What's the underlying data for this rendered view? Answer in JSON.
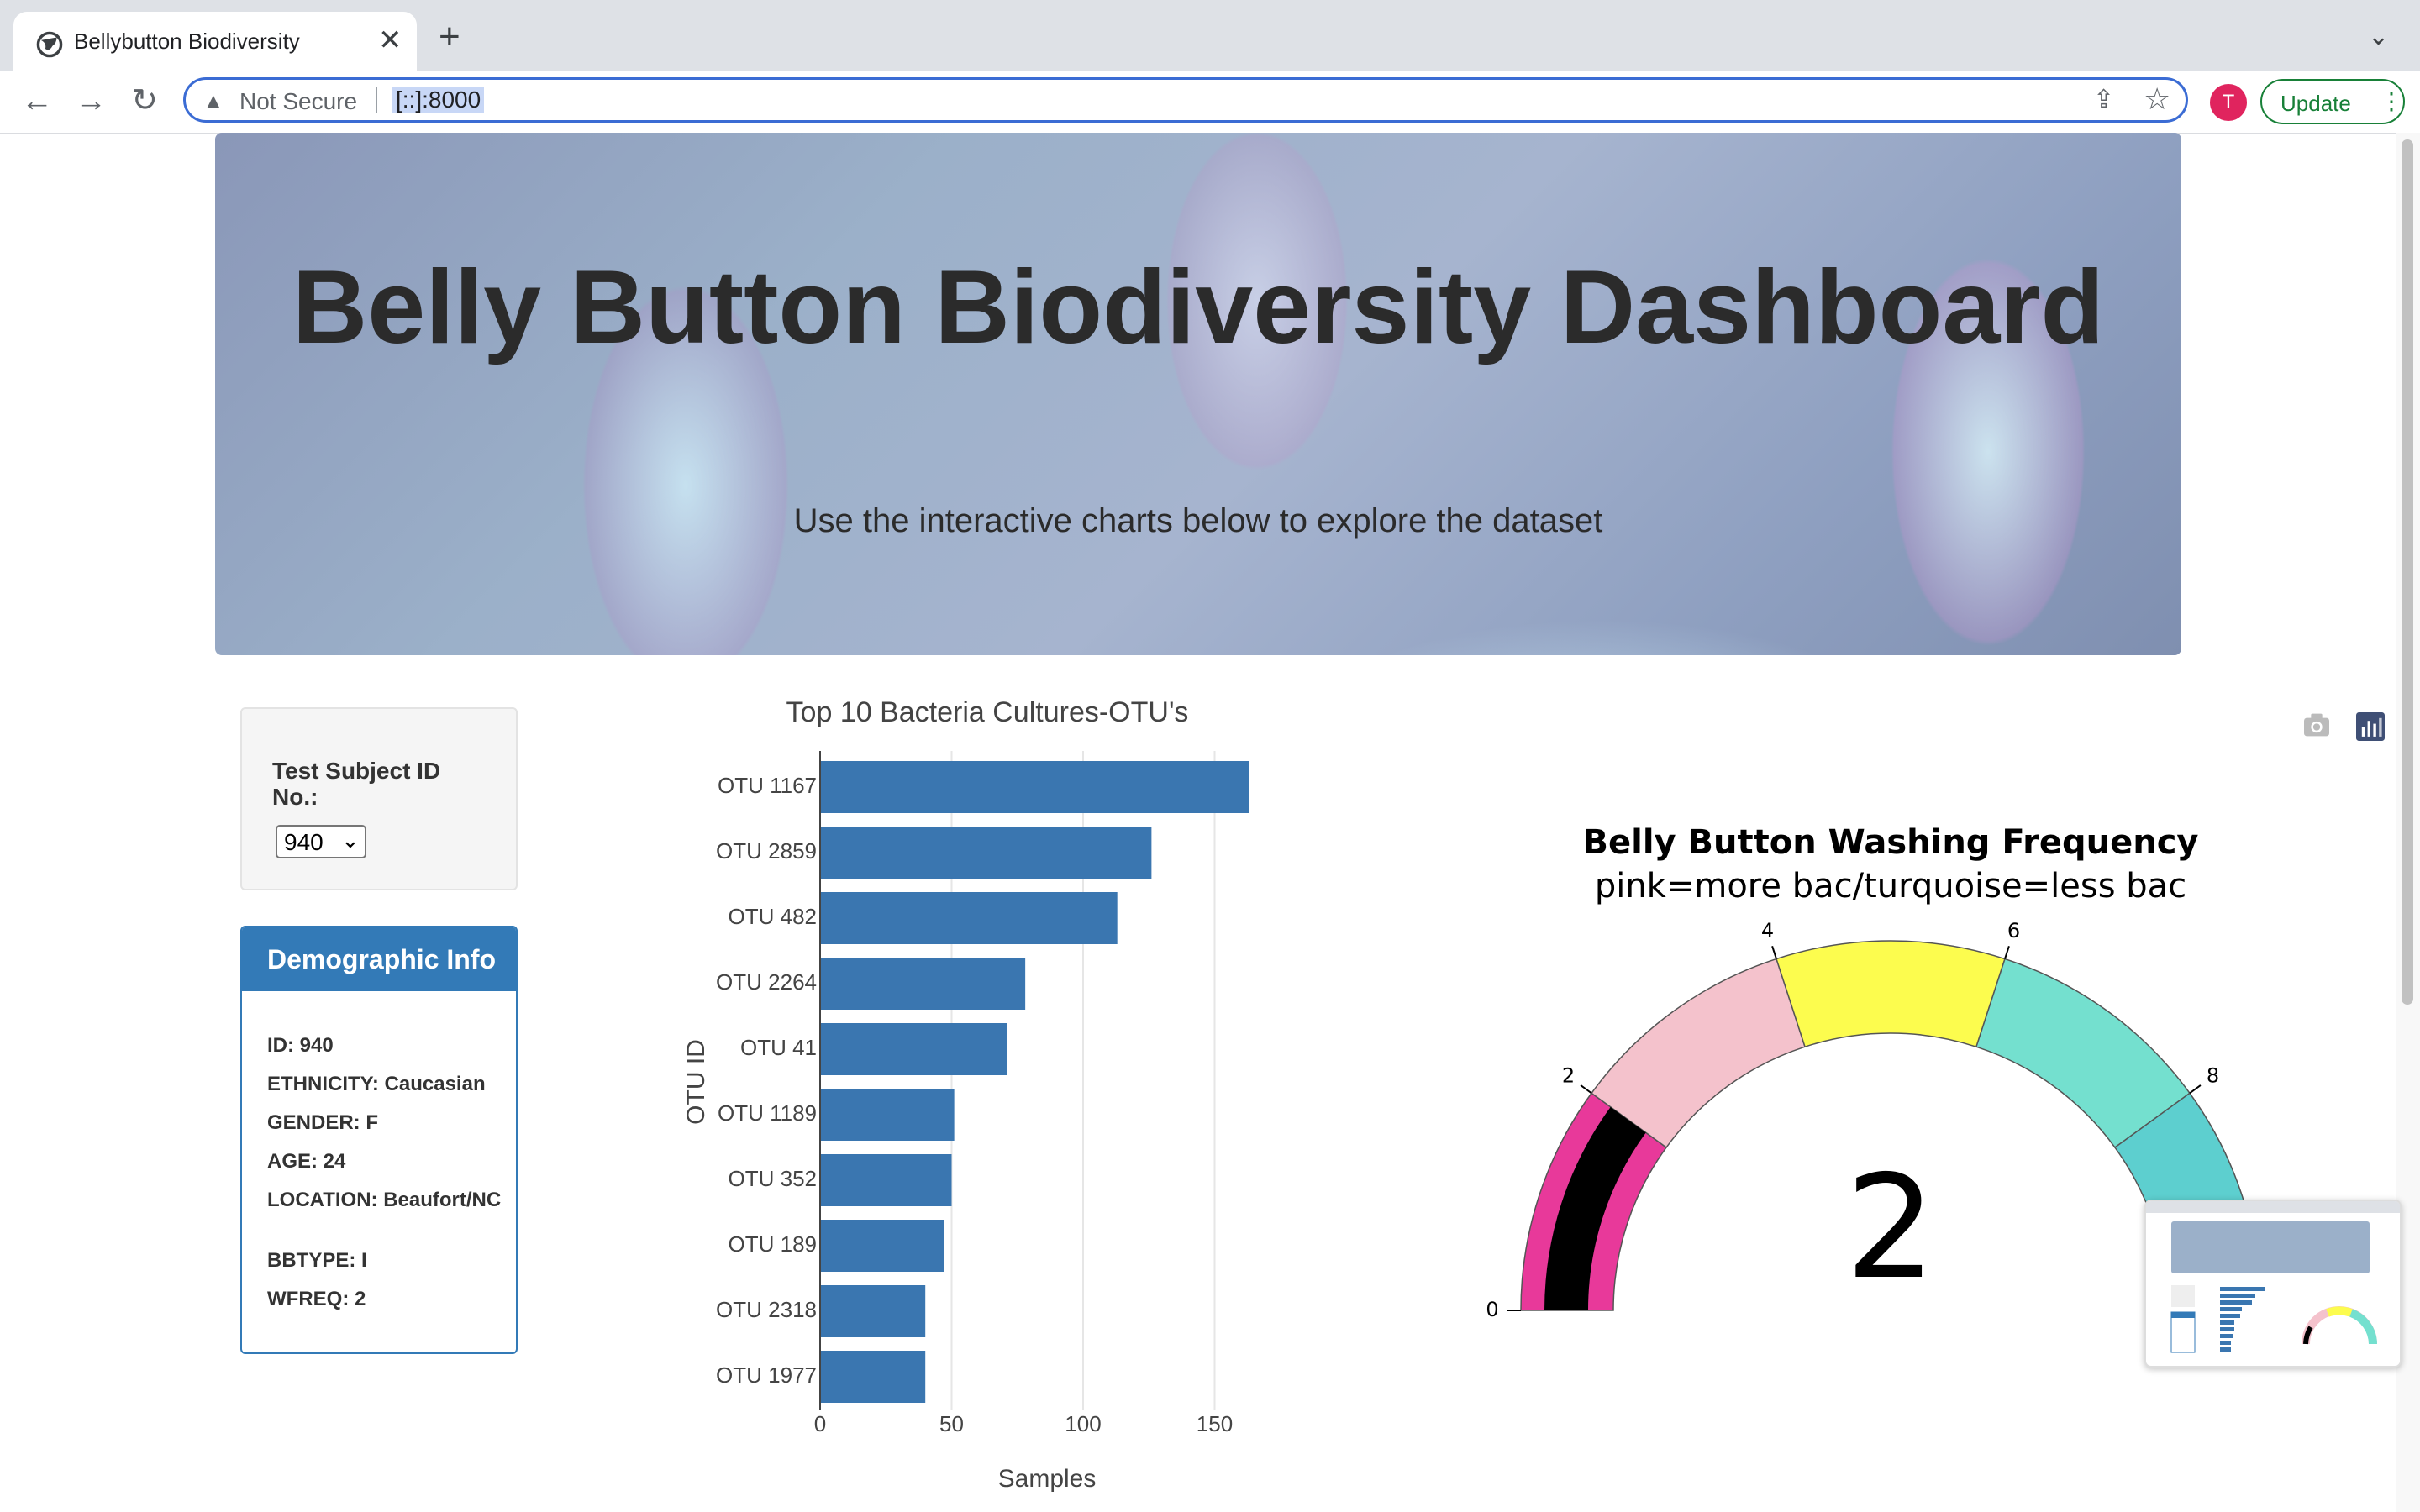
{
  "browser": {
    "tab_title": "Bellybutton Biodiversity",
    "close_glyph": "✕",
    "new_tab_glyph": "+",
    "tab_menu_glyph": "⌄",
    "back_glyph": "←",
    "forward_glyph": "→",
    "reload_glyph": "↻",
    "warning_glyph": "▲",
    "security_text": "Not Secure",
    "url": "[::]:8000",
    "share_glyph": "⇪",
    "star_glyph": "☆",
    "profile_initial": "T",
    "update_label": "Update",
    "menu_glyph": "⋮"
  },
  "header": {
    "title": "Belly Button Biodiversity Dashboard",
    "subtitle": "Use the interactive charts below to explore the dataset"
  },
  "selector": {
    "label": "Test Subject ID No.:",
    "selected": "940",
    "arrow_glyph": "⌄"
  },
  "demographics": {
    "title": "Demographic Info",
    "lines": [
      "ID: 940",
      "ETHNICITY: Caucasian",
      "GENDER: F",
      "AGE: 24",
      "LOCATION: Beaufort/NC",
      "BBTYPE: I",
      "WFREQ: 2"
    ]
  },
  "chart_data": [
    {
      "type": "bar",
      "orientation": "horizontal",
      "title": "Top 10 Bacteria Cultures-OTU's",
      "xlabel": "Samples",
      "ylabel": "OTU ID",
      "categories": [
        "OTU 1167",
        "OTU 2859",
        "OTU 482",
        "OTU 2264",
        "OTU 41",
        "OTU 1189",
        "OTU 352",
        "OTU 189",
        "OTU 2318",
        "OTU 1977"
      ],
      "values": [
        163,
        126,
        113,
        78,
        71,
        51,
        50,
        47,
        40,
        40
      ],
      "xlim": [
        0,
        175
      ],
      "xticks": [
        0,
        50,
        100,
        150
      ],
      "color": "#3a76b0",
      "grid": true
    },
    {
      "type": "gauge",
      "title": "Belly Button Washing Frequency",
      "subtitle": "pink=more bac/turquoise=less bac",
      "value": 2,
      "range": [
        0,
        10
      ],
      "ticks": [
        0,
        2,
        4,
        6,
        8
      ],
      "bands": [
        {
          "from": 0,
          "to": 2,
          "color": "#e8399a"
        },
        {
          "from": 2,
          "to": 4,
          "color": "#f4c2cc"
        },
        {
          "from": 4,
          "to": 6,
          "color": "#fcfc4e"
        },
        {
          "from": 6,
          "to": 8,
          "color": "#74e0cf"
        },
        {
          "from": 8,
          "to": 10,
          "color": "#5dcfcf"
        }
      ],
      "bar_color": "#000000"
    }
  ]
}
